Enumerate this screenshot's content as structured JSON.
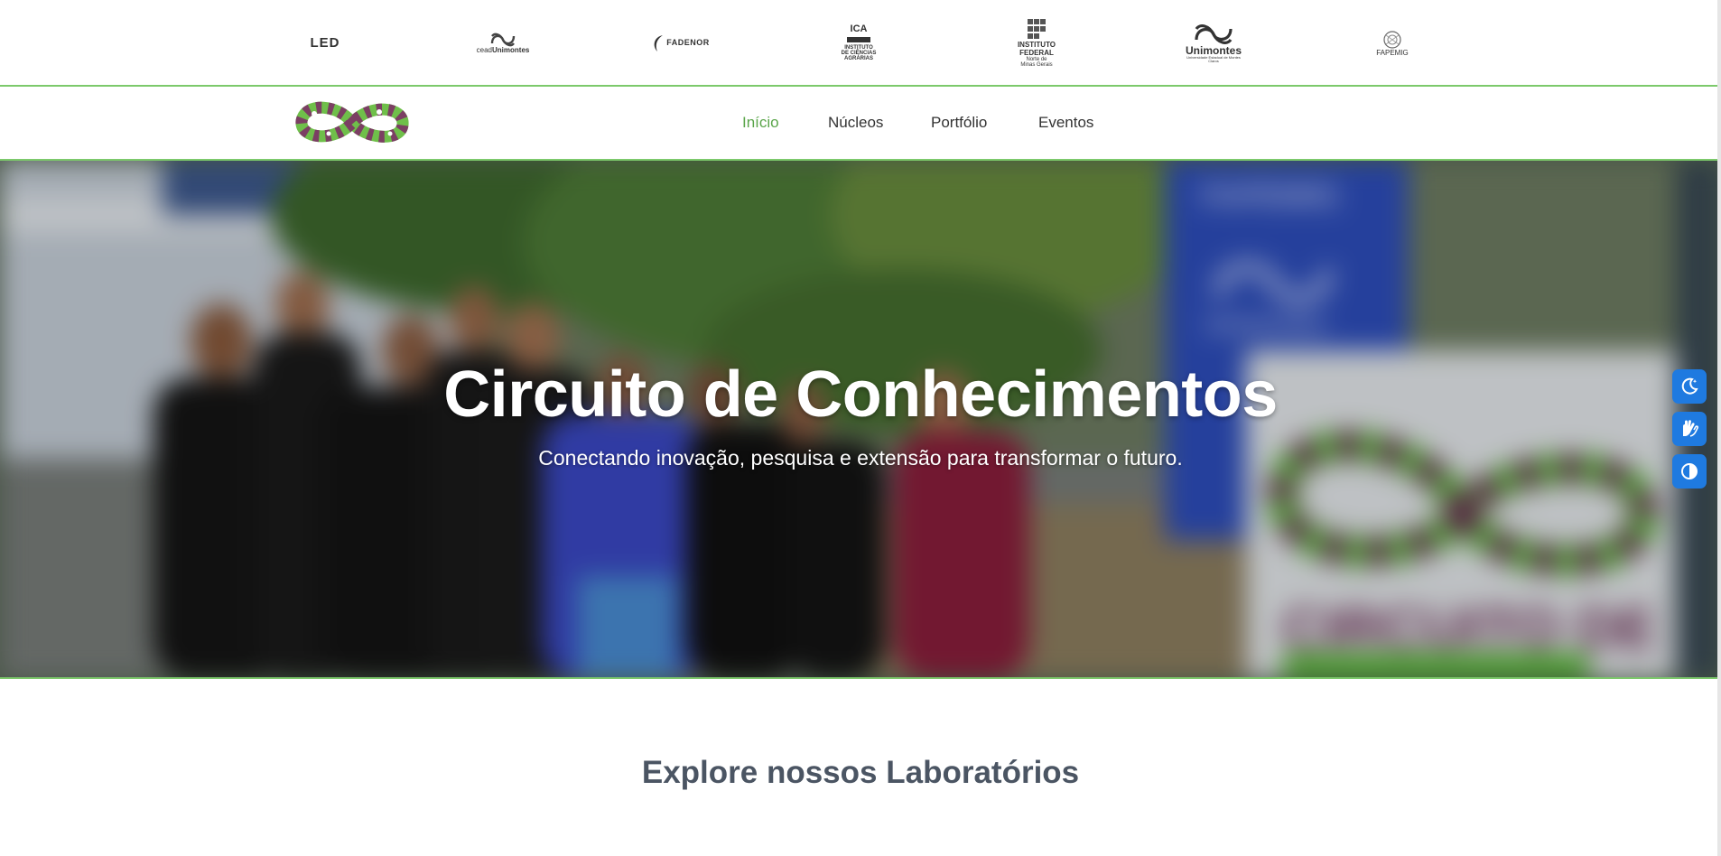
{
  "sponsors": {
    "led": "LED",
    "ceadunimontes_a": "cead",
    "ceadunimontes_b": "Unimontes",
    "fadenor": "FADENOR",
    "ica_title": "ICA",
    "ica_lines": "INSTITUTO\nDE CIÊNCIAS\nAGRÁRIAS",
    "if_lines": "INSTITUTO\nFEDERAL",
    "if_sub": "Norte de\nMinas Gerais",
    "unimontes": "Unimontes",
    "unimontes_sub": "Universidade Estadual de Montes Claros",
    "fapemig": "FAPEMIG"
  },
  "nav": {
    "items": [
      {
        "label": "Início",
        "active": true
      },
      {
        "label": "Núcleos",
        "active": false
      },
      {
        "label": "Portfólio",
        "active": false
      },
      {
        "label": "Eventos",
        "active": false
      }
    ]
  },
  "hero": {
    "title": "Circuito de Conhecimentos",
    "subtitle": "Conectando inovação, pesquisa e extensão para transformar o futuro.",
    "sign_text_1": "FAPEMIG",
    "sign_text_2": "Unimontes",
    "sign_text_3": "CIRCUITO DE"
  },
  "accessibility": {
    "buttons": [
      {
        "icon": "dark-mode-icon"
      },
      {
        "icon": "sign-language-icon"
      },
      {
        "icon": "contrast-icon"
      }
    ]
  },
  "section": {
    "title": "Explore nossos Laboratórios"
  },
  "colors": {
    "accent_green": "#5aa54a",
    "border_green": "#7cc96b",
    "a11y_blue": "#1f7ae0",
    "heading_gray": "#4b5563"
  }
}
